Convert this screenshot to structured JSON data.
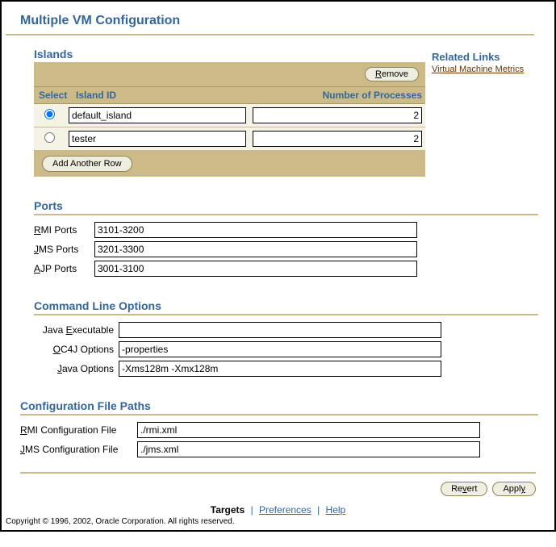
{
  "title": "Multiple VM Configuration",
  "islands": {
    "heading": "Islands",
    "remove_label": "Remove",
    "add_row_label": "Add Another Row",
    "headers": {
      "select": "Select",
      "island_id": "Island ID",
      "num_proc": "Number of Processes"
    },
    "rows": [
      {
        "selected": true,
        "id": "default_island",
        "procs": "2"
      },
      {
        "selected": false,
        "id": "tester",
        "procs": "2"
      }
    ]
  },
  "related": {
    "heading": "Related Links",
    "link": "Virtual Machine Metrics"
  },
  "ports": {
    "heading": "Ports",
    "rmi_label": "RMI Ports",
    "rmi_value": "3101-3200",
    "jms_label": "JMS Ports",
    "jms_value": "3201-3300",
    "ajp_label": "AJP Ports",
    "ajp_value": "3001-3100"
  },
  "cmd": {
    "heading": "Command Line Options",
    "java_exec_label": "Java Executable",
    "java_exec_value": "",
    "oc4j_label": "OC4J Options",
    "oc4j_value": "-properties",
    "java_opts_label": "Java Options",
    "java_opts_value": "-Xms128m -Xmx128m"
  },
  "paths": {
    "heading": "Configuration File Paths",
    "rmi_label": "RMI Configuration File",
    "rmi_value": "./rmi.xml",
    "jms_label": "JMS Configuration File",
    "jms_value": "./jms.xml"
  },
  "actions": {
    "revert": "Revert",
    "apply": "Apply"
  },
  "footer": {
    "targets": "Targets",
    "prefs": "Preferences",
    "help": "Help",
    "copyright": "Copyright © 1996, 2002, Oracle Corporation. All rights reserved."
  }
}
